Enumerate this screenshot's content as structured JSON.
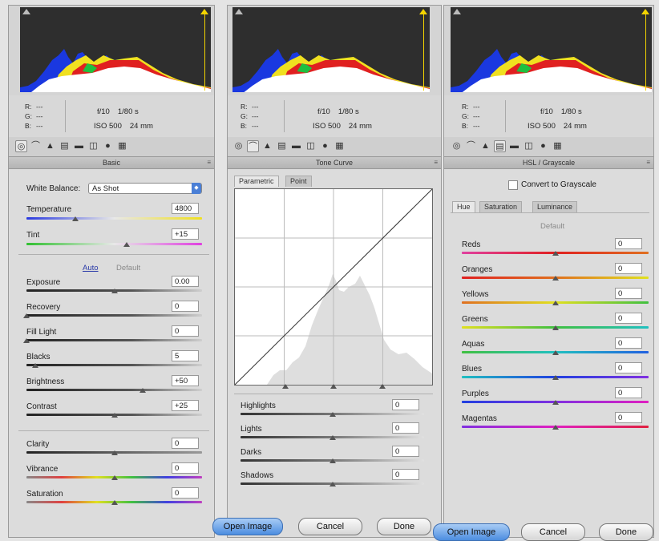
{
  "histogram": {
    "r_label": "R:",
    "g_label": "G:",
    "b_label": "B:",
    "rgb_value": "---",
    "aperture": "f/10",
    "shutter": "1/80 s",
    "iso": "ISO 500",
    "focal": "24 mm"
  },
  "tool_icons": [
    "basic-icon",
    "tone-curve-icon",
    "detail-icon",
    "hsl-icon",
    "split-toning-icon",
    "lens-icon",
    "effects-icon",
    "calibration-icon"
  ],
  "basic": {
    "title": "Basic",
    "white_balance_label": "White Balance:",
    "white_balance_value": "As Shot",
    "temperature_label": "Temperature",
    "temperature_value": "4800",
    "temperature_level": 0.28,
    "tint_label": "Tint",
    "tint_value": "+15",
    "tint_level": 0.57,
    "auto_label": "Auto",
    "default_label": "Default",
    "sliders": [
      {
        "label": "Exposure",
        "value": "0.00",
        "level": 0.5
      },
      {
        "label": "Recovery",
        "value": "0",
        "level": 0.0
      },
      {
        "label": "Fill Light",
        "value": "0",
        "level": 0.0
      },
      {
        "label": "Blacks",
        "value": "5",
        "level": 0.05
      },
      {
        "label": "Brightness",
        "value": "+50",
        "level": 0.66
      },
      {
        "label": "Contrast",
        "value": "+25",
        "level": 0.5
      }
    ],
    "presence": [
      {
        "label": "Clarity",
        "value": "0",
        "level": 0.5
      },
      {
        "label": "Vibrance",
        "value": "0",
        "level": 0.5
      },
      {
        "label": "Saturation",
        "value": "0",
        "level": 0.5
      }
    ]
  },
  "tone_curve": {
    "title": "Tone Curve",
    "tab_parametric": "Parametric",
    "tab_point": "Point",
    "sliders": [
      {
        "label": "Highlights",
        "value": "0",
        "level": 0.5
      },
      {
        "label": "Lights",
        "value": "0",
        "level": 0.5
      },
      {
        "label": "Darks",
        "value": "0",
        "level": 0.5
      },
      {
        "label": "Shadows",
        "value": "0",
        "level": 0.5
      }
    ]
  },
  "hsl": {
    "title": "HSL / Grayscale",
    "convert_label": "Convert to Grayscale",
    "tab_hue": "Hue",
    "tab_saturation": "Saturation",
    "tab_luminance": "Luminance",
    "default_label": "Default",
    "sliders": [
      {
        "label": "Reds",
        "value": "0",
        "level": 0.5
      },
      {
        "label": "Oranges",
        "value": "0",
        "level": 0.5
      },
      {
        "label": "Yellows",
        "value": "0",
        "level": 0.5
      },
      {
        "label": "Greens",
        "value": "0",
        "level": 0.5
      },
      {
        "label": "Aquas",
        "value": "0",
        "level": 0.5
      },
      {
        "label": "Blues",
        "value": "0",
        "level": 0.5
      },
      {
        "label": "Purples",
        "value": "0",
        "level": 0.5
      },
      {
        "label": "Magentas",
        "value": "0",
        "level": 0.5
      }
    ]
  },
  "buttons": {
    "open_image": "Open Image",
    "cancel": "Cancel",
    "done": "Done"
  }
}
